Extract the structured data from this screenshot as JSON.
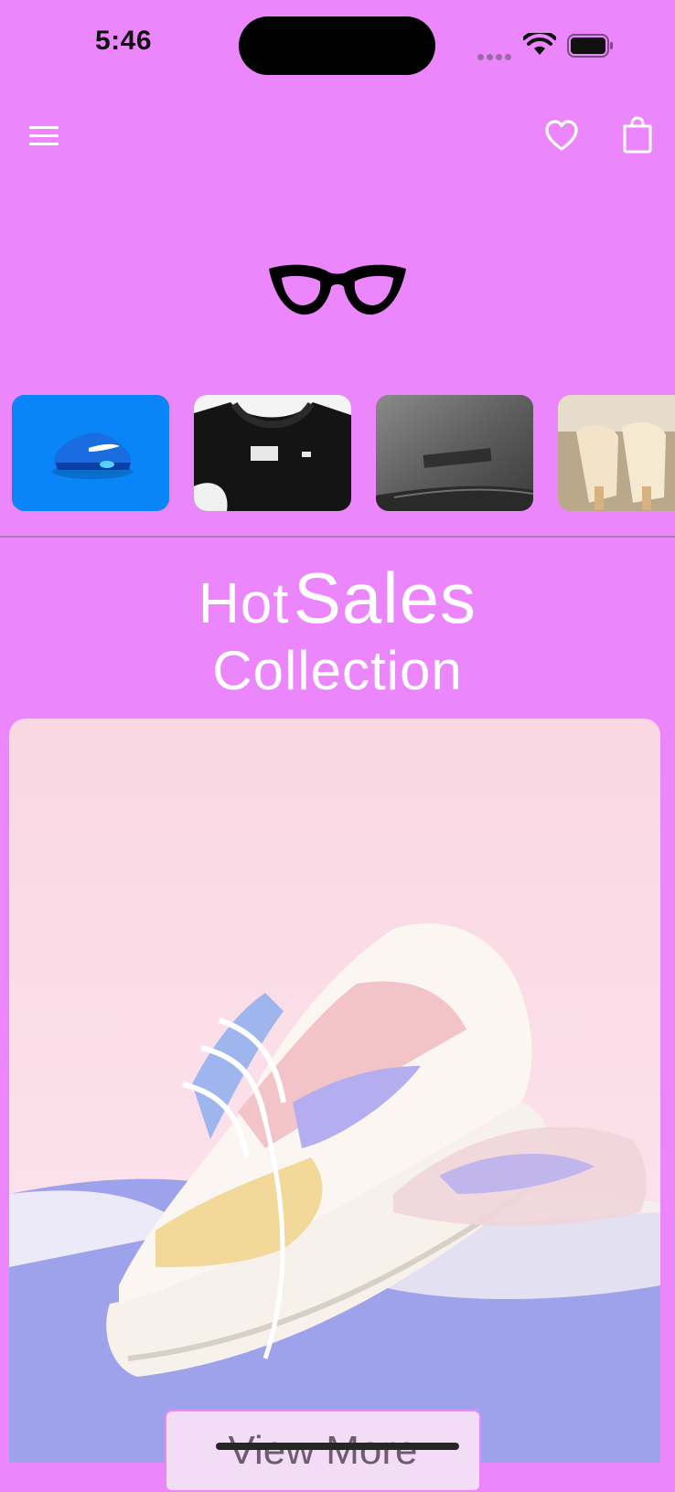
{
  "status_bar": {
    "time": "5:46"
  },
  "header": {
    "menu_icon": "hamburger-menu-icon",
    "favorites_icon": "heart-icon",
    "cart_icon": "shopping-bag-icon"
  },
  "logo": {
    "icon": "cat-eye-glasses-icon"
  },
  "categories": [
    {
      "icon": "blue-sneaker-image"
    },
    {
      "icon": "black-tshirt-image"
    },
    {
      "icon": "grey-fabric-image"
    },
    {
      "icon": "sandals-image"
    }
  ],
  "hero": {
    "title_word_1": "Hot",
    "title_word_2": "Sales",
    "subtitle": "Collection",
    "image": "pastel-sneaker-image",
    "button_label": "View More"
  },
  "colors": {
    "background": "#EC86FD",
    "button_bg": "#F3DDF6",
    "text_white": "#FFFFFF"
  }
}
